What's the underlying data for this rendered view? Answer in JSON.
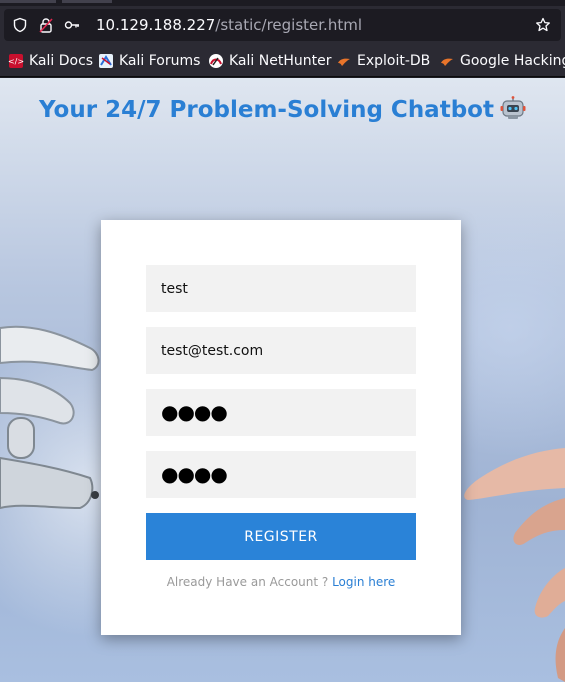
{
  "browser": {
    "url_host": "10.129.188.227",
    "url_path": "/static/register.html",
    "bookmarks": [
      {
        "label": "Kali Docs",
        "icon": "kali-docs-icon"
      },
      {
        "label": "Kali Forums",
        "icon": "kali-forums-icon"
      },
      {
        "label": "Kali NetHunter",
        "icon": "kali-nethunter-icon"
      },
      {
        "label": "Exploit-DB",
        "icon": "exploit-db-icon"
      },
      {
        "label": "Google Hacking",
        "icon": "google-hacking-icon"
      }
    ]
  },
  "hero": {
    "title": "Your 24/7 Problem-Solving Chatbot"
  },
  "form": {
    "username_value": "test",
    "email_value": "test@test.com",
    "password_masked": "●●●●",
    "confirm_masked": "●●●●",
    "register_label": "REGISTER",
    "login_prompt": "Already Have an Account ? ",
    "login_link": "Login here"
  },
  "colors": {
    "accent": "#2a83d8",
    "title": "#2a7fd4"
  }
}
